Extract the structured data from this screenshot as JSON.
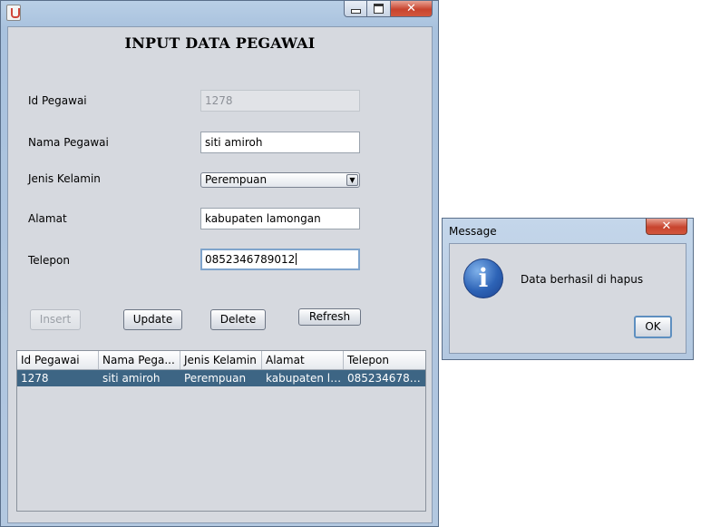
{
  "form": {
    "title": "INPUT DATA PEGAWAI",
    "labels": {
      "id": "Id Pegawai",
      "nama": "Nama Pegawai",
      "jenis": "Jenis Kelamin",
      "alamat": "Alamat",
      "telepon": "Telepon"
    },
    "values": {
      "id": "1278",
      "nama": "siti amiroh",
      "jenis": "Perempuan",
      "alamat": "kabupaten lamongan",
      "telepon": "0852346789012"
    },
    "buttons": {
      "insert": "Insert",
      "update": "Update",
      "delete": "Delete",
      "refresh": "Refresh"
    }
  },
  "table": {
    "columns": [
      "Id Pegawai",
      "Nama Pega...",
      "Jenis Kelamin",
      "Alamat",
      "Telepon"
    ],
    "rows": [
      [
        "1278",
        "siti amiroh",
        "Perempuan",
        "kabupaten la...",
        "0852346789..."
      ]
    ]
  },
  "dialog": {
    "title": "Message",
    "message": "Data berhasil di hapus",
    "ok": "OK",
    "close": "✕"
  },
  "window": {
    "close": "✕"
  }
}
